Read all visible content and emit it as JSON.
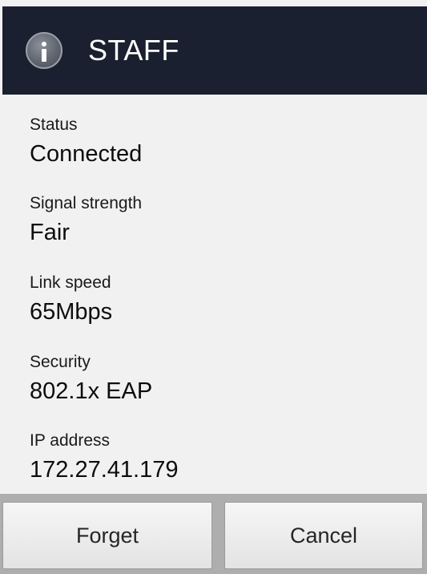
{
  "header": {
    "title": "STAFF",
    "icon": "info-icon"
  },
  "details": {
    "status": {
      "label": "Status",
      "value": "Connected"
    },
    "signal": {
      "label": "Signal strength",
      "value": "Fair"
    },
    "link_speed": {
      "label": "Link speed",
      "value": "65Mbps"
    },
    "security": {
      "label": "Security",
      "value": "802.1x EAP"
    },
    "ip": {
      "label": "IP address",
      "value": "172.27.41.179"
    }
  },
  "buttons": {
    "forget_label": "Forget",
    "cancel_label": "Cancel"
  },
  "colors": {
    "titlebar": "#1a2030",
    "content_bg": "#f1f1f1",
    "button_bar": "#aeaeae"
  }
}
